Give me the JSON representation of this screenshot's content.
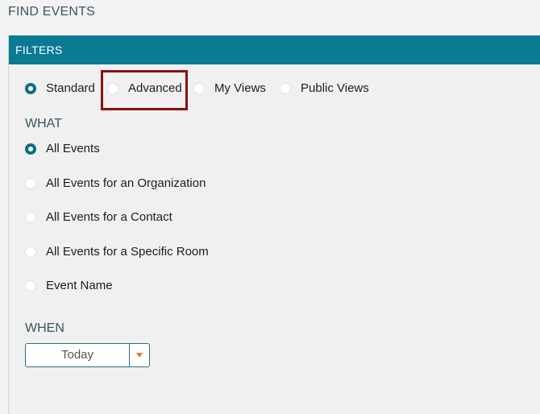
{
  "page": {
    "title": "FIND EVENTS"
  },
  "filters": {
    "header": "FILTERS",
    "modes": [
      {
        "label": "Standard",
        "selected": true
      },
      {
        "label": "Advanced",
        "selected": false
      },
      {
        "label": "My Views",
        "selected": false
      },
      {
        "label": "Public Views",
        "selected": false
      }
    ]
  },
  "what": {
    "label": "WHAT",
    "options": [
      {
        "label": "All Events",
        "selected": true
      },
      {
        "label": "All Events for an Organization",
        "selected": false
      },
      {
        "label": "All Events for a Contact",
        "selected": false
      },
      {
        "label": "All Events for a Specific Room",
        "selected": false
      },
      {
        "label": "Event Name",
        "selected": false
      }
    ]
  },
  "when": {
    "label": "WHEN",
    "value": "Today"
  },
  "colors": {
    "header_bg": "#0b7b93",
    "radio_selected": "#0c6f86",
    "highlight_border": "#8b1010",
    "caret": "#d9772d"
  }
}
